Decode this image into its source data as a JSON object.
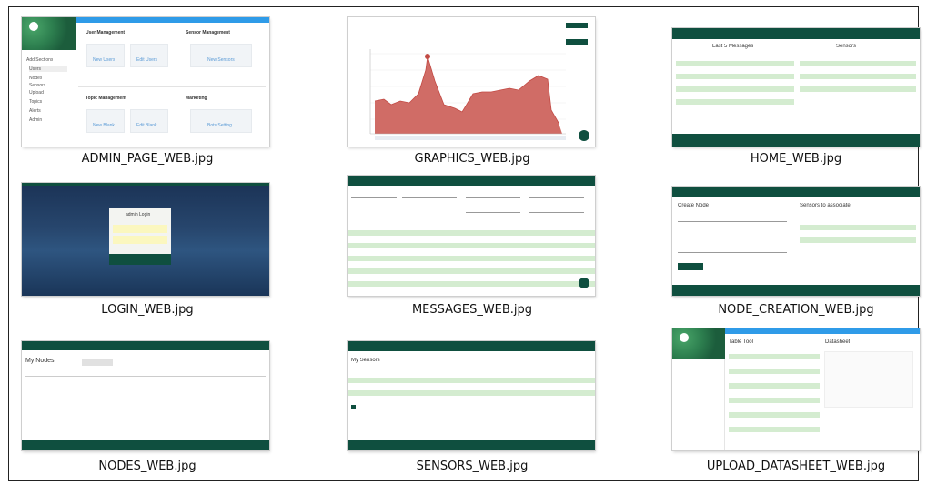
{
  "files": [
    {
      "caption": "ADMIN_PAGE_WEB.jpg"
    },
    {
      "caption": "GRAPHICS_WEB.jpg"
    },
    {
      "caption": "HOME_WEB.jpg"
    },
    {
      "caption": "LOGIN_WEB.jpg"
    },
    {
      "caption": "MESSAGES_WEB.jpg"
    },
    {
      "caption": "NODE_CREATION_WEB.jpg"
    },
    {
      "caption": "NODES_WEB.jpg"
    },
    {
      "caption": "SENSORS_WEB.jpg"
    },
    {
      "caption": "UPLOAD_DATASHEET_WEB.jpg"
    }
  ],
  "admin": {
    "user_management": "User Management",
    "sensor_management": "Sensor Management",
    "topic_management": "Topic Management",
    "marketing": "Marketing",
    "buttons": [
      "New Users",
      "Edit Users",
      "New Sensors",
      "New Blank",
      "Edit Blank",
      "Bots Setting"
    ]
  },
  "home": {
    "last_messages": "Last 5 Messages",
    "sensors": "Sensors"
  },
  "login": {
    "title": "admin Login"
  },
  "node_creation": {
    "create_node": "Create Node",
    "sensors_to_associate": "Sensors to associate"
  },
  "nodes": {
    "title": "My Nodes"
  },
  "sensors": {
    "title": "My Sensors"
  },
  "upload": {
    "table_tool": "Table Tool",
    "datasheet": "Datasheet"
  },
  "colors": {
    "brand_green": "#0f4f3f",
    "row_green": "#d4ecd0",
    "chart_fill": "#d06c66",
    "blue_header": "#2f9be8"
  }
}
